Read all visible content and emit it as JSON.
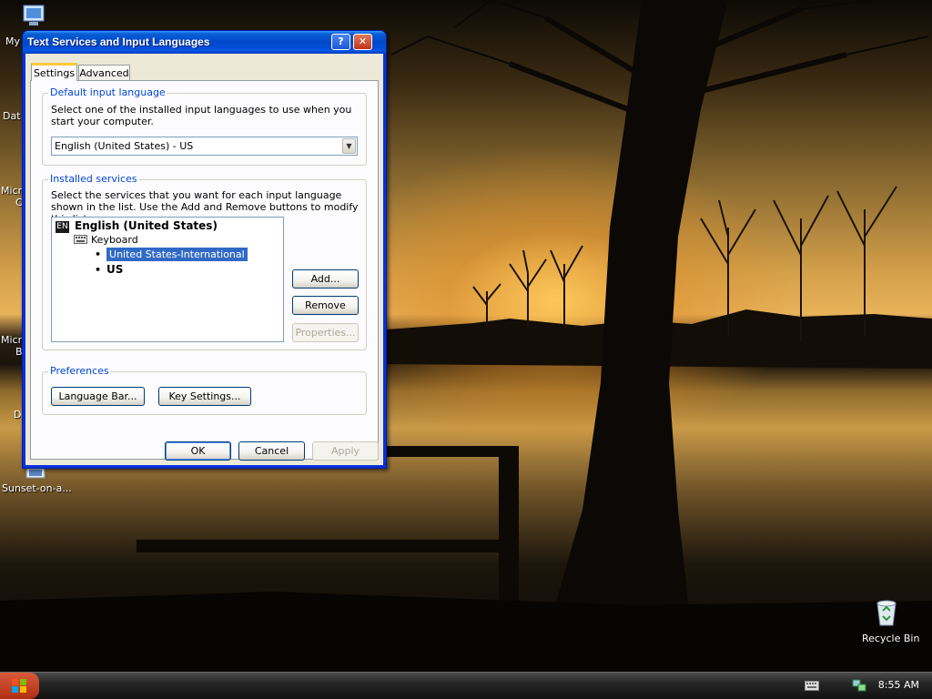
{
  "desktop": {
    "icons_left": [
      "My",
      "Dat",
      "Micro",
      "C",
      "Micro",
      "B",
      "D"
    ],
    "sunset_file_label": "Sunset-on-a...",
    "recycle_bin_label": "Recycle Bin"
  },
  "dialog": {
    "title": "Text Services and Input Languages",
    "help_button": "?",
    "close_button": "✕",
    "tabs": [
      {
        "label": "Settings",
        "active": true
      },
      {
        "label": "Advanced",
        "active": false
      }
    ],
    "default_input": {
      "group_title": "Default input language",
      "description": "Select one of the installed input languages to use when you start your computer.",
      "selected_value": "English (United States) - US"
    },
    "installed_services": {
      "group_title": "Installed services",
      "description": "Select the services that you want for each input language shown in the list. Use the Add and Remove buttons to modify this list.",
      "language_badge": "EN",
      "language": "English (United States)",
      "category": "Keyboard",
      "items": [
        "United States-International",
        "US"
      ],
      "selected_item": "United States-International",
      "add_button": "Add...",
      "remove_button": "Remove",
      "properties_button": "Properties..."
    },
    "preferences": {
      "group_title": "Preferences",
      "language_bar_button": "Language Bar...",
      "key_settings_button": "Key Settings..."
    },
    "footer": {
      "ok": "OK",
      "cancel": "Cancel",
      "apply": "Apply"
    }
  },
  "taskbar": {
    "clock": "8:55 AM"
  }
}
